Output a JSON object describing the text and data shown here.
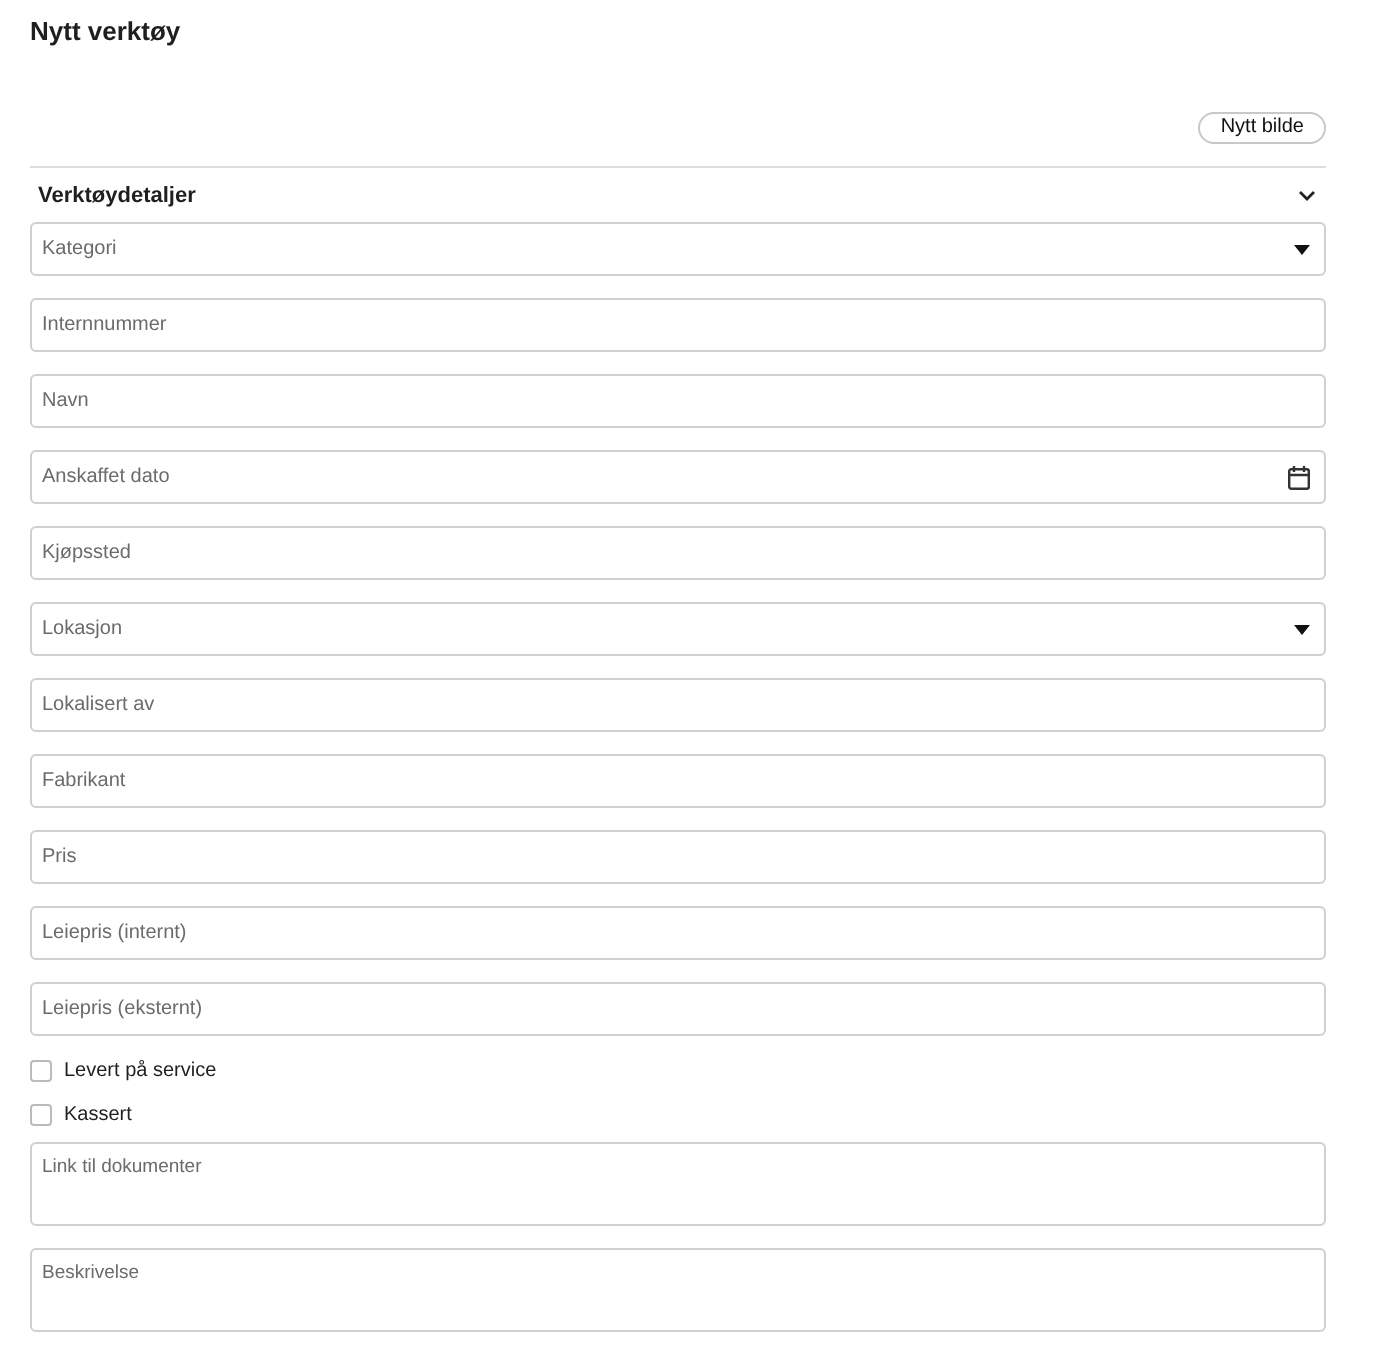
{
  "title": "Nytt verktøy",
  "new_image_button": "Nytt bilde",
  "section": {
    "title": "Verktøydetaljer",
    "expanded": true
  },
  "fields": [
    {
      "kind": "select",
      "placeholder": "Kategori"
    },
    {
      "kind": "text",
      "placeholder": "Internnummer"
    },
    {
      "kind": "text",
      "placeholder": "Navn"
    },
    {
      "kind": "date",
      "placeholder": "Anskaffet dato"
    },
    {
      "kind": "text",
      "placeholder": "Kjøpssted"
    },
    {
      "kind": "select",
      "placeholder": "Lokasjon"
    },
    {
      "kind": "text",
      "placeholder": "Lokalisert av"
    },
    {
      "kind": "text",
      "placeholder": "Fabrikant"
    },
    {
      "kind": "text",
      "placeholder": "Pris"
    },
    {
      "kind": "text",
      "placeholder": "Leiepris (internt)"
    },
    {
      "kind": "text",
      "placeholder": "Leiepris (eksternt)"
    }
  ],
  "checkboxes": [
    {
      "label": "Levert på service",
      "checked": false
    },
    {
      "label": "Kassert",
      "checked": false
    }
  ],
  "textareas": [
    {
      "placeholder": "Link til dokumenter"
    },
    {
      "placeholder": "Beskrivelse"
    }
  ]
}
